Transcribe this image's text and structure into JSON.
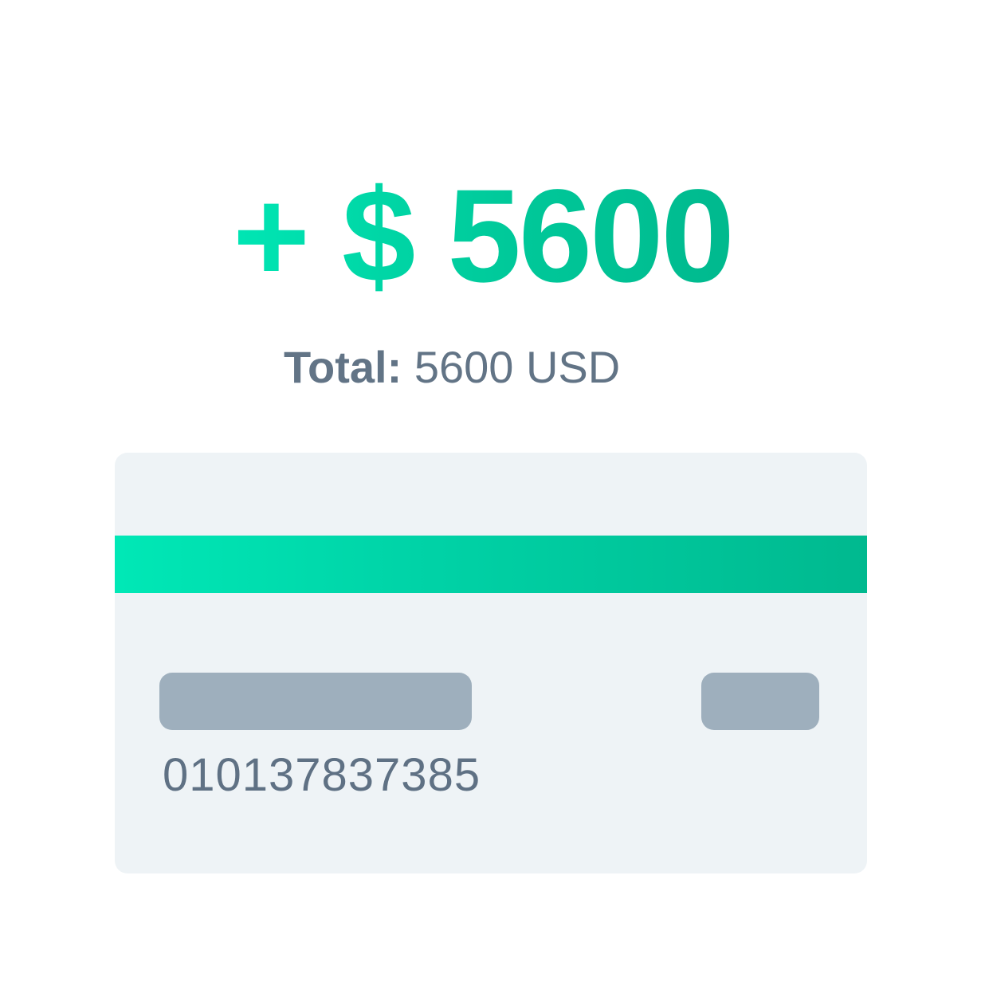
{
  "amount": {
    "text": "+ $ 5600"
  },
  "total": {
    "label": "Total:",
    "value": "5600 USD"
  },
  "card": {
    "number": "010137837385"
  },
  "colors": {
    "accent_start": "#00e6b4",
    "accent_end": "#00b98e",
    "text_muted": "#627486",
    "card_background": "#eef3f6",
    "card_placeholder": "#9eafbd"
  }
}
